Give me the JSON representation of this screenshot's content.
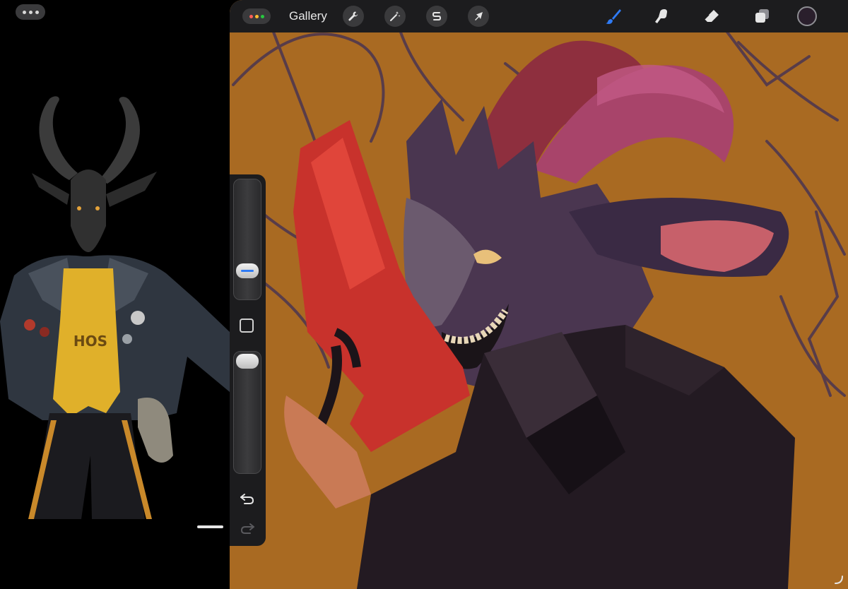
{
  "toolbar": {
    "gallery_label": "Gallery",
    "actions_icon": "wrench-icon",
    "adjustments_icon": "magic-wand-icon",
    "selection_icon": "selection-s-icon",
    "transform_icon": "arrow-cursor-icon",
    "brush_icon": "brush-icon",
    "smudge_icon": "smudge-finger-icon",
    "eraser_icon": "eraser-icon",
    "layers_icon": "layers-icon",
    "current_color": "#2a1f2c",
    "active_tool_color": "#2f7bf5"
  },
  "sidebar": {
    "brush_size_level": 0.2,
    "opacity_level": 1.0,
    "undo_icon": "undo-arrow-icon",
    "redo_icon": "redo-arrow-icon"
  },
  "palette": {
    "canvas_background": "#a96a22",
    "gun_red": "#c8322c",
    "horn_pink": "#a8446a",
    "fur_purple": "#4a3650",
    "jacket_dark": "#231a22"
  }
}
